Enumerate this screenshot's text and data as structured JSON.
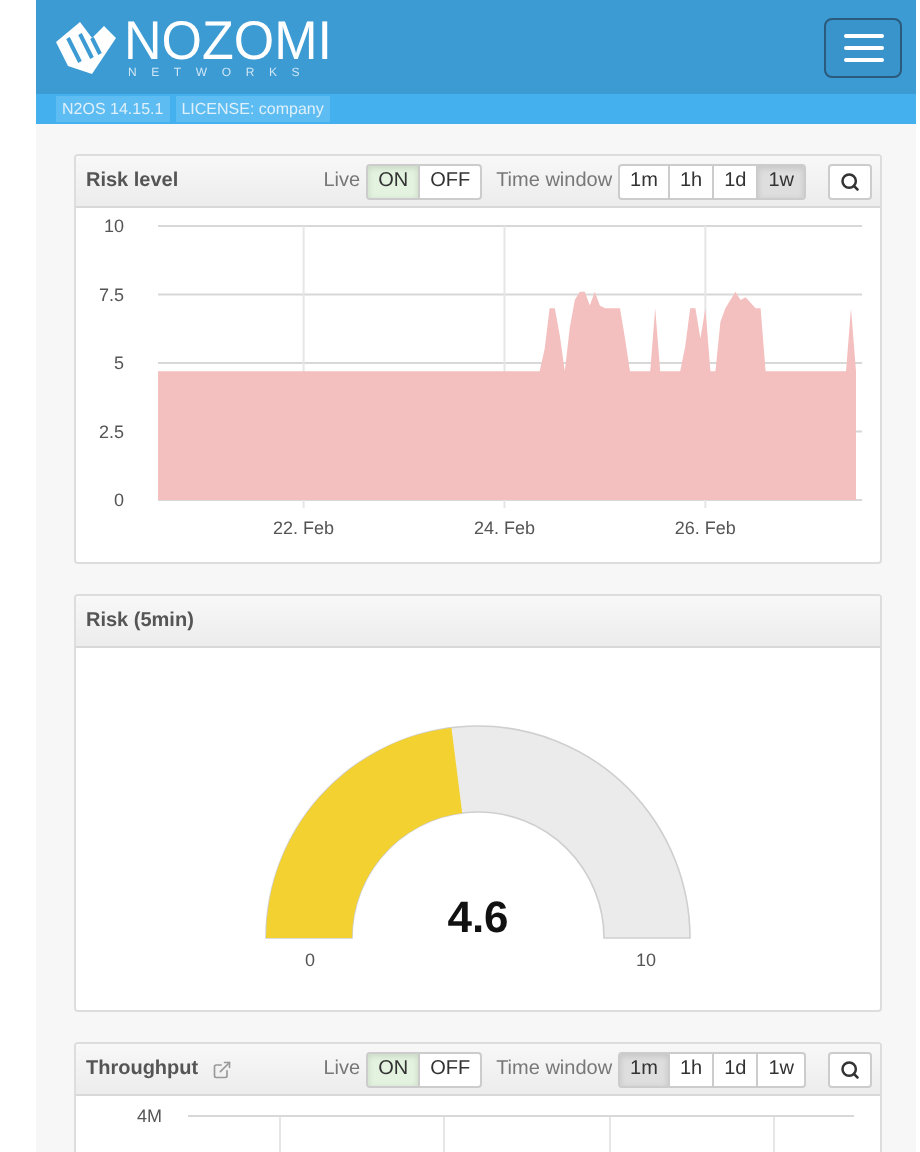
{
  "header": {
    "brand": "NOZOMI",
    "brand_sub": "NETWORKS",
    "badges": [
      "N2OS 14.15.1",
      "LICENSE: company"
    ]
  },
  "panels": [
    {
      "kind": "timeseries",
      "title": "Risk level",
      "external_link": false,
      "live_label": "Live",
      "live_options": [
        {
          "label": "ON",
          "selected": true
        },
        {
          "label": "OFF",
          "selected": false
        }
      ],
      "window_label": "Time window",
      "windows": [
        {
          "label": "1m",
          "selected": false
        },
        {
          "label": "1h",
          "selected": false
        },
        {
          "label": "1d",
          "selected": false
        },
        {
          "label": "1w",
          "selected": true
        }
      ],
      "chart_data": {
        "type": "area",
        "grid": true,
        "categories": [
          null,
          null,
          null,
          null,
          null,
          null,
          null,
          null,
          null,
          null,
          null,
          null,
          null,
          null,
          null,
          null,
          null,
          null,
          null,
          null,
          null,
          null,
          null,
          null,
          null,
          null,
          null,
          null,
          null,
          "22. Feb",
          null,
          null,
          null,
          null,
          null,
          null,
          null,
          null,
          null,
          null,
          null,
          null,
          null,
          null,
          null,
          null,
          null,
          null,
          null,
          null,
          null,
          null,
          null,
          null,
          null,
          null,
          null,
          null,
          null,
          null,
          null,
          null,
          null,
          null,
          null,
          null,
          null,
          null,
          null,
          "24. Feb",
          null,
          null,
          null,
          null,
          null,
          null,
          null,
          null,
          null,
          null,
          null,
          null,
          null,
          null,
          null,
          null,
          null,
          null,
          null,
          null,
          null,
          null,
          null,
          null,
          null,
          null,
          null,
          null,
          null,
          null,
          null,
          null,
          null,
          null,
          null,
          null,
          null,
          null,
          null,
          "26. Feb",
          null,
          null,
          null,
          null,
          null,
          null,
          null,
          null,
          null,
          null,
          null,
          null,
          null,
          null,
          null,
          null,
          null,
          null,
          null,
          null,
          null,
          null,
          null,
          null,
          null,
          null,
          null,
          null,
          null,
          null
        ],
        "values": [
          4.7,
          4.7,
          4.7,
          4.7,
          4.7,
          4.7,
          4.7,
          4.7,
          4.7,
          4.7,
          4.7,
          4.7,
          4.7,
          4.7,
          4.7,
          4.7,
          4.7,
          4.7,
          4.7,
          4.7,
          4.7,
          4.7,
          4.7,
          4.7,
          4.7,
          4.7,
          4.7,
          4.7,
          4.7,
          4.7,
          4.7,
          4.7,
          4.7,
          4.7,
          4.7,
          4.7,
          4.7,
          4.7,
          4.7,
          4.7,
          4.7,
          4.7,
          4.7,
          4.7,
          4.7,
          4.7,
          4.7,
          4.7,
          4.7,
          4.7,
          4.7,
          4.7,
          4.7,
          4.7,
          4.7,
          4.7,
          4.7,
          4.7,
          4.7,
          4.7,
          4.7,
          4.7,
          4.7,
          4.7,
          4.7,
          4.7,
          4.7,
          4.7,
          4.7,
          4.7,
          4.7,
          4.7,
          4.7,
          4.7,
          4.7,
          4.7,
          4.7,
          5.5,
          7,
          7,
          6,
          4.7,
          6.3,
          7.3,
          7.6,
          7.6,
          7.1,
          7.6,
          7.1,
          7,
          7,
          7,
          7,
          5.9,
          4.7,
          4.7,
          4.7,
          4.7,
          4.7,
          7,
          4.7,
          4.7,
          4.7,
          4.7,
          4.7,
          5.6,
          7,
          7,
          5.9,
          7,
          4.7,
          4.7,
          6.5,
          7,
          7.3,
          7.6,
          7.3,
          7.4,
          7.2,
          7,
          7,
          4.7,
          4.7,
          4.7,
          4.7,
          4.7,
          4.7,
          4.7,
          4.7,
          4.7,
          4.7,
          4.7,
          4.7,
          4.7,
          4.7,
          4.7,
          4.7,
          4.7,
          7,
          4.7
        ],
        "ylim": [
          0,
          10
        ],
        "yticks": [
          {
            "value": 0,
            "label": "0"
          },
          {
            "value": 2.5,
            "label": "2.5"
          },
          {
            "value": 5,
            "label": "5"
          },
          {
            "value": 7.5,
            "label": "7.5"
          },
          {
            "value": 10,
            "label": "10"
          }
        ]
      }
    },
    {
      "kind": "gauge",
      "title": "Risk (5min)",
      "value": "4.6",
      "min_label": "0",
      "max_label": "10"
    },
    {
      "kind": "timeseries",
      "title": "Throughput",
      "external_link": true,
      "live_label": "Live",
      "live_options": [
        {
          "label": "ON",
          "selected": true
        },
        {
          "label": "OFF",
          "selected": false
        }
      ],
      "window_label": "Time window",
      "windows": [
        {
          "label": "1m",
          "selected": true
        },
        {
          "label": "1h",
          "selected": false
        },
        {
          "label": "1d",
          "selected": false
        },
        {
          "label": "1w",
          "selected": false
        }
      ],
      "axis_label": "4M"
    }
  ]
}
